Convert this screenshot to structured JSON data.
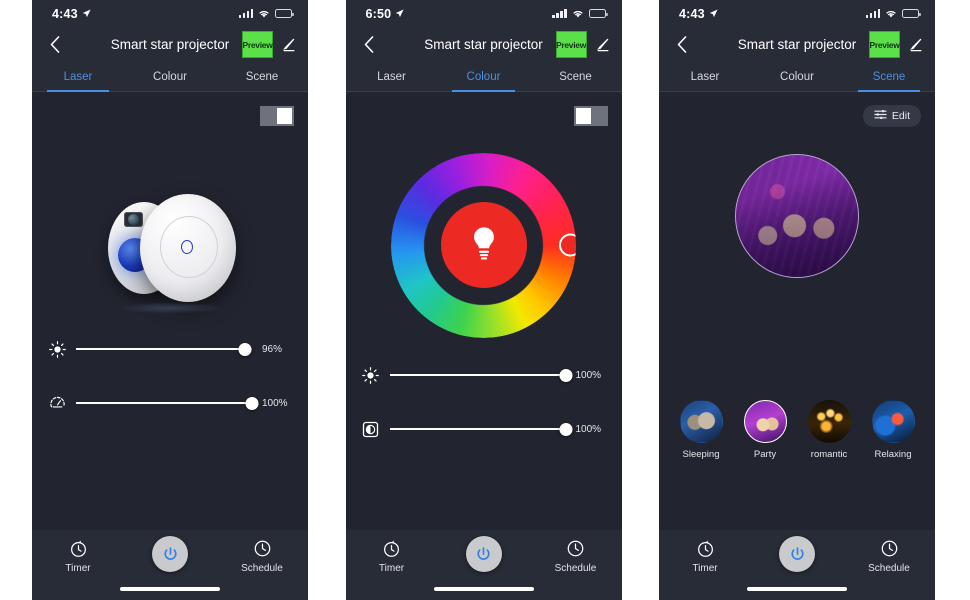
{
  "panels": [
    {
      "id": "laser",
      "status": {
        "time": "4:43",
        "location_icon": "location-arrow-icon",
        "signal_icon": "cellular-signal-icon",
        "wifi_icon": "wifi-icon",
        "battery_icon": "battery-icon"
      },
      "nav": {
        "back_icon": "chevron-left-icon",
        "title": "Smart star projector",
        "preview_label": "Preview",
        "edit_icon": "pencil-underline-icon"
      },
      "tabs": [
        {
          "label": "Laser",
          "active": true
        },
        {
          "label": "Colour",
          "active": false
        },
        {
          "label": "Scene",
          "active": false
        }
      ],
      "toggle": {
        "name": "power-toggle",
        "state": "on"
      },
      "device_image": "star-projector-device",
      "sliders": [
        {
          "icon": "brightness-sun-icon",
          "value": 96,
          "value_label": "96%"
        },
        {
          "icon": "speed-gauge-icon",
          "value": 100,
          "value_label": "100%"
        }
      ],
      "bottom": {
        "timer_label": "Timer",
        "timer_icon": "timer-icon",
        "power_icon": "power-icon",
        "schedule_label": "Schedule",
        "schedule_icon": "clock-icon"
      }
    },
    {
      "id": "colour",
      "status": {
        "time": "6:50",
        "location_icon": "location-arrow-icon",
        "signal_icon": "cellular-signal-icon",
        "wifi_icon": "wifi-icon",
        "battery_icon": "battery-icon"
      },
      "nav": {
        "back_icon": "chevron-left-icon",
        "title": "Smart star projector",
        "preview_label": "Preview",
        "edit_icon": "pencil-underline-icon"
      },
      "tabs": [
        {
          "label": "Laser",
          "active": false
        },
        {
          "label": "Colour",
          "active": true
        },
        {
          "label": "Scene",
          "active": false
        }
      ],
      "toggle": {
        "name": "power-toggle",
        "state": "off"
      },
      "colour_wheel": {
        "selected_colour": "#ec2a23",
        "hub_icon": "light-bulb-icon",
        "handle_angle_deg": 0
      },
      "sliders": [
        {
          "icon": "brightness-sun-icon",
          "value": 100,
          "value_label": "100%"
        },
        {
          "icon": "saturation-icon",
          "value": 100,
          "value_label": "100%"
        }
      ],
      "bottom": {
        "timer_label": "Timer",
        "timer_icon": "timer-icon",
        "power_icon": "power-icon",
        "schedule_label": "Schedule",
        "schedule_icon": "clock-icon"
      }
    },
    {
      "id": "scene",
      "status": {
        "time": "4:43",
        "location_icon": "location-arrow-icon",
        "signal_icon": "cellular-signal-icon",
        "wifi_icon": "wifi-icon",
        "battery_icon": "battery-icon"
      },
      "nav": {
        "back_icon": "chevron-left-icon",
        "title": "Smart star projector",
        "preview_label": "Preview",
        "edit_icon": "pencil-underline-icon"
      },
      "tabs": [
        {
          "label": "Laser",
          "active": false
        },
        {
          "label": "Colour",
          "active": false
        },
        {
          "label": "Scene",
          "active": true
        }
      ],
      "edit_button": {
        "label": "Edit",
        "icon": "sliders-icon"
      },
      "hero_scene": "Party",
      "scenes": [
        {
          "label": "Sleeping",
          "selected": false,
          "thumb": "sleeping-thumb"
        },
        {
          "label": "Party",
          "selected": true,
          "thumb": "party-thumb"
        },
        {
          "label": "romantic",
          "selected": false,
          "thumb": "romantic-thumb"
        },
        {
          "label": "Relaxing",
          "selected": false,
          "thumb": "relaxing-thumb"
        }
      ],
      "bottom": {
        "timer_label": "Timer",
        "timer_icon": "timer-icon",
        "power_icon": "power-icon",
        "schedule_label": "Schedule",
        "schedule_icon": "clock-icon"
      }
    }
  ],
  "theme": {
    "accent_blue": "#4a90e2",
    "preview_green": "#5ce04a",
    "panel_bg": "#282c37",
    "body_bg": "#22252f",
    "selected_colour": "#ec2a23"
  }
}
